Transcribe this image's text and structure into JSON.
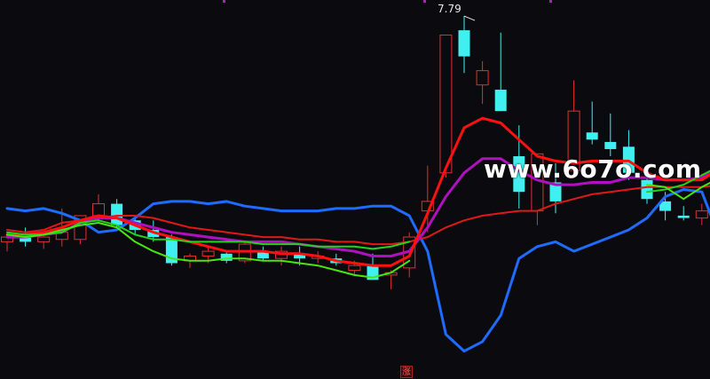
{
  "chart_data": {
    "type": "candlestick",
    "title": "",
    "xlabel": "",
    "ylabel": "",
    "ylim": [
      6.3,
      7.82
    ],
    "grid": false,
    "legend": "none",
    "peak_label": "7.79",
    "candles": [
      {
        "o": 6.84,
        "h": 6.88,
        "l": 6.8,
        "c": 6.86
      },
      {
        "o": 6.86,
        "h": 6.9,
        "l": 6.82,
        "c": 6.84
      },
      {
        "o": 6.84,
        "h": 6.87,
        "l": 6.81,
        "c": 6.86
      },
      {
        "o": 6.85,
        "h": 6.98,
        "l": 6.82,
        "c": 6.88
      },
      {
        "o": 6.85,
        "h": 6.95,
        "l": 6.83,
        "c": 6.95
      },
      {
        "o": 6.95,
        "h": 7.04,
        "l": 6.92,
        "c": 7.0
      },
      {
        "o": 7.0,
        "h": 7.02,
        "l": 6.9,
        "c": 6.91
      },
      {
        "o": 6.93,
        "h": 6.95,
        "l": 6.87,
        "c": 6.89
      },
      {
        "o": 6.89,
        "h": 6.93,
        "l": 6.84,
        "c": 6.86
      },
      {
        "o": 6.86,
        "h": 6.87,
        "l": 6.74,
        "c": 6.75
      },
      {
        "o": 6.76,
        "h": 6.79,
        "l": 6.73,
        "c": 6.78
      },
      {
        "o": 6.78,
        "h": 6.82,
        "l": 6.75,
        "c": 6.8
      },
      {
        "o": 6.79,
        "h": 6.8,
        "l": 6.75,
        "c": 6.76
      },
      {
        "o": 6.76,
        "h": 6.84,
        "l": 6.75,
        "c": 6.83
      },
      {
        "o": 6.8,
        "h": 6.82,
        "l": 6.76,
        "c": 6.77
      },
      {
        "o": 6.77,
        "h": 6.82,
        "l": 6.74,
        "c": 6.8
      },
      {
        "o": 6.79,
        "h": 6.82,
        "l": 6.74,
        "c": 6.77
      },
      {
        "o": 6.77,
        "h": 6.8,
        "l": 6.75,
        "c": 6.78
      },
      {
        "o": 6.77,
        "h": 6.79,
        "l": 6.74,
        "c": 6.75
      },
      {
        "o": 6.72,
        "h": 6.76,
        "l": 6.7,
        "c": 6.74
      },
      {
        "o": 6.74,
        "h": 6.79,
        "l": 6.68,
        "c": 6.68
      },
      {
        "o": 6.7,
        "h": 6.72,
        "l": 6.64,
        "c": 6.71
      },
      {
        "o": 6.73,
        "h": 6.88,
        "l": 6.69,
        "c": 6.86
      },
      {
        "o": 6.97,
        "h": 7.16,
        "l": 6.88,
        "c": 7.01
      },
      {
        "o": 7.13,
        "h": 7.71,
        "l": 7.11,
        "c": 7.71
      },
      {
        "o": 7.73,
        "h": 7.79,
        "l": 7.55,
        "c": 7.62
      },
      {
        "o": 7.5,
        "h": 7.6,
        "l": 7.42,
        "c": 7.56
      },
      {
        "o": 7.48,
        "h": 7.72,
        "l": 7.39,
        "c": 7.39
      },
      {
        "o": 7.2,
        "h": 7.33,
        "l": 6.98,
        "c": 7.05
      },
      {
        "o": 6.97,
        "h": 7.21,
        "l": 6.91,
        "c": 7.21
      },
      {
        "o": 7.09,
        "h": 7.17,
        "l": 6.96,
        "c": 7.01
      },
      {
        "o": 7.14,
        "h": 7.52,
        "l": 7.12,
        "c": 7.39
      },
      {
        "o": 7.3,
        "h": 7.43,
        "l": 7.25,
        "c": 7.27
      },
      {
        "o": 7.26,
        "h": 7.38,
        "l": 7.2,
        "c": 7.23
      },
      {
        "o": 7.24,
        "h": 7.31,
        "l": 7.1,
        "c": 7.13
      },
      {
        "o": 7.1,
        "h": 7.14,
        "l": 7.0,
        "c": 7.02
      },
      {
        "o": 7.01,
        "h": 7.05,
        "l": 6.93,
        "c": 6.97
      },
      {
        "o": 6.95,
        "h": 6.99,
        "l": 6.93,
        "c": 6.94
      },
      {
        "o": 6.94,
        "h": 7.0,
        "l": 6.91,
        "c": 6.97
      },
      {
        "o": 7.27,
        "h": 7.52,
        "l": 7.2,
        "c": 7.49
      }
    ],
    "series": [
      {
        "color": "#1e6bff",
        "width": 3,
        "values": [
          6.98,
          6.97,
          6.98,
          6.96,
          6.93,
          6.88,
          6.89,
          6.94,
          7.0,
          7.01,
          7.01,
          7.0,
          7.01,
          6.99,
          6.98,
          6.97,
          6.97,
          6.97,
          6.98,
          6.98,
          6.99,
          6.99,
          6.95,
          6.8,
          6.45,
          6.38,
          6.42,
          6.53,
          6.77,
          6.82,
          6.84,
          6.8,
          6.83,
          6.86,
          6.89,
          6.94,
          7.03,
          7.06,
          7.05,
          6.85
        ]
      },
      {
        "color": "#e01818",
        "width": 2,
        "values": [
          6.89,
          6.88,
          6.89,
          6.92,
          6.93,
          6.94,
          6.95,
          6.95,
          6.94,
          6.92,
          6.9,
          6.89,
          6.88,
          6.87,
          6.86,
          6.86,
          6.85,
          6.85,
          6.84,
          6.84,
          6.83,
          6.83,
          6.84,
          6.86,
          6.9,
          6.93,
          6.95,
          6.96,
          6.97,
          6.97,
          7.0,
          7.02,
          7.04,
          7.05,
          7.06,
          7.07,
          7.07,
          7.07,
          7.07,
          7.08
        ]
      },
      {
        "color": "#b010c0",
        "width": 3,
        "values": [
          6.86,
          6.86,
          6.87,
          6.88,
          6.92,
          6.94,
          6.94,
          6.92,
          6.9,
          6.88,
          6.87,
          6.86,
          6.85,
          6.84,
          6.84,
          6.84,
          6.83,
          6.82,
          6.81,
          6.8,
          6.78,
          6.78,
          6.8,
          6.9,
          7.03,
          7.13,
          7.19,
          7.19,
          7.14,
          7.1,
          7.08,
          7.08,
          7.09,
          7.09,
          7.11,
          7.11,
          7.1,
          7.1,
          7.11,
          7.15
        ]
      },
      {
        "color": "#ff1010",
        "width": 3,
        "values": [
          6.87,
          6.87,
          6.88,
          6.9,
          6.93,
          6.95,
          6.94,
          6.91,
          6.88,
          6.86,
          6.84,
          6.82,
          6.8,
          6.8,
          6.8,
          6.79,
          6.79,
          6.78,
          6.76,
          6.75,
          6.74,
          6.74,
          6.78,
          6.96,
          7.15,
          7.32,
          7.36,
          7.34,
          7.27,
          7.2,
          7.18,
          7.17,
          7.18,
          7.18,
          7.18,
          7.13,
          7.1,
          7.1,
          7.1,
          7.15
        ]
      },
      {
        "color": "#22d41a",
        "width": 2,
        "values": [
          6.88,
          6.87,
          6.87,
          6.88,
          6.92,
          6.93,
          6.91,
          6.87,
          6.85,
          6.85,
          6.84,
          6.84,
          6.84,
          6.84,
          6.83,
          6.83,
          6.83,
          6.82,
          6.82,
          6.82,
          6.81,
          6.82,
          6.84,
          null,
          null,
          null,
          null,
          null,
          null,
          null,
          null,
          null,
          null,
          null,
          null,
          7.05,
          7.06,
          7.08,
          7.12,
          7.16
        ]
      },
      {
        "color": "#46e80f",
        "width": 2,
        "values": [
          6.87,
          6.86,
          6.87,
          6.89,
          6.91,
          6.92,
          6.9,
          6.84,
          6.8,
          6.77,
          6.76,
          6.76,
          6.77,
          6.77,
          6.76,
          6.76,
          6.75,
          6.74,
          6.72,
          6.7,
          6.69,
          6.71,
          6.76,
          null,
          null,
          null,
          null,
          null,
          null,
          null,
          null,
          null,
          null,
          null,
          null,
          7.08,
          7.07,
          7.02,
          7.07,
          7.11
        ]
      }
    ]
  },
  "overlays": {
    "watermark": "www.6o7o.com",
    "badge": "涨"
  }
}
